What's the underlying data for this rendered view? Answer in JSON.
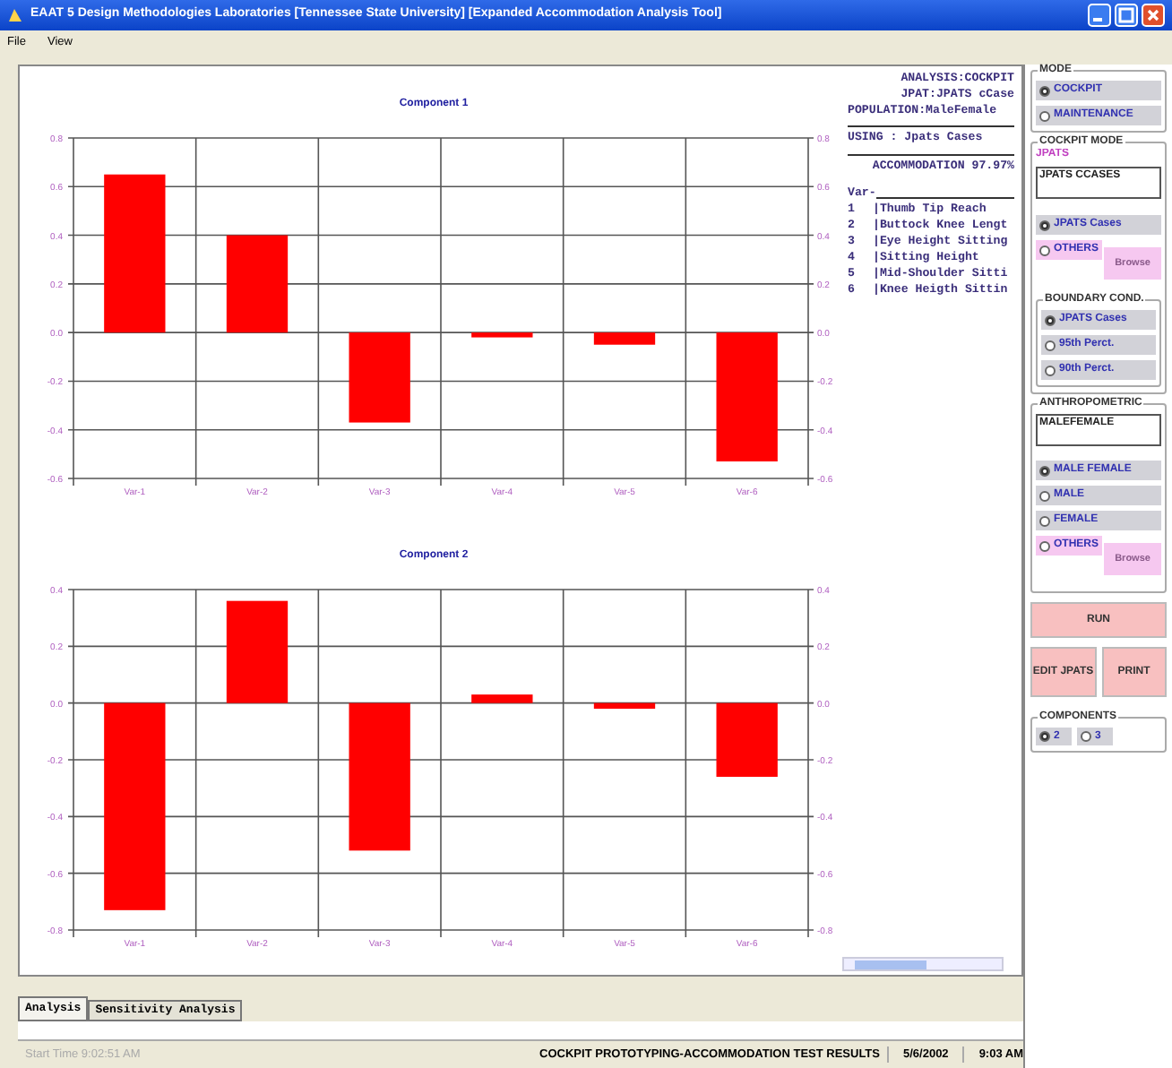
{
  "window": {
    "title": "EAAT 5 Design Methodologies Laboratories [Tennessee State University]   [Expanded Accommodation Analysis Tool]"
  },
  "menu": [
    "File",
    "View"
  ],
  "charts": [
    {
      "chart_data": {
        "type": "bar",
        "title": "Component 1",
        "categories": [
          "Var-1",
          "Var-2",
          "Var-3",
          "Var-4",
          "Var-5",
          "Var-6"
        ],
        "grid": true,
        "series": [
          {
            "color": "#ff0000",
            "values": [
              0.65,
              0.4,
              -0.37,
              -0.02,
              -0.05,
              -0.53
            ]
          }
        ],
        "ylim": [
          -0.6,
          0.8
        ],
        "yticks": [
          {
            "value": 0.8,
            "label": "0.8"
          },
          {
            "value": 0.6,
            "label": "0.6"
          },
          {
            "value": 0.4,
            "label": "0.4"
          },
          {
            "value": 0.2,
            "label": "0.2"
          },
          {
            "value": 0,
            "label": "0.0"
          },
          {
            "value": -0.2,
            "label": "-0.2"
          },
          {
            "value": -0.4,
            "label": "-0.4"
          },
          {
            "value": -0.6,
            "label": "-0.6"
          }
        ]
      }
    },
    {
      "chart_data": {
        "type": "bar",
        "title": "Component 2",
        "categories": [
          "Var-1",
          "Var-2",
          "Var-3",
          "Var-4",
          "Var-5",
          "Var-6"
        ],
        "grid": true,
        "series": [
          {
            "color": "#ff0000",
            "values": [
              -0.73,
              0.36,
              -0.52,
              0.03,
              -0.02,
              -0.26
            ]
          }
        ],
        "ylim": [
          -0.8,
          0.4
        ],
        "yticks": [
          {
            "value": 0.4,
            "label": "0.4"
          },
          {
            "value": 0.2,
            "label": "0.2"
          },
          {
            "value": 0,
            "label": "0.0"
          },
          {
            "value": -0.2,
            "label": "-0.2"
          },
          {
            "value": -0.4,
            "label": "-0.4"
          },
          {
            "value": -0.6,
            "label": "-0.6"
          },
          {
            "value": -0.8,
            "label": "-0.8"
          }
        ]
      }
    }
  ],
  "info": {
    "header": [
      "ANALYSIS:COCKPIT",
      "JPAT:JPATS cCase",
      "POPULATION:MaleFemale"
    ],
    "using": "USING : Jpats Cases",
    "accommodation": "ACCOMMODATION 97.97%",
    "var_heading": "Var-",
    "variables": [
      {
        "number": "1",
        "name": "|Thumb Tip Reach"
      },
      {
        "number": "2",
        "name": "|Buttock Knee Lengt"
      },
      {
        "number": "3",
        "name": "|Eye Height Sitting"
      },
      {
        "number": "4",
        "name": "|Sitting Height"
      },
      {
        "number": "5",
        "name": "|Mid-Shoulder Sitti"
      },
      {
        "number": "6",
        "name": "|Knee Heigth Sittin"
      }
    ]
  },
  "tabs": [
    {
      "label": "Analysis",
      "selected": true
    },
    {
      "label": "Sensitivity Analysis",
      "selected": false
    }
  ],
  "panel": {
    "mode": {
      "title": "MODE",
      "options": [
        {
          "label": "COCKPIT",
          "selected": true
        },
        {
          "label": "MAINTENANCE",
          "selected": false
        }
      ]
    },
    "cockpit_mode": {
      "title": "COCKPIT MODE",
      "jpats_label": "JPATS",
      "jpats_value": "JPATS CCASES",
      "options": [
        {
          "label": "JPATS Cases",
          "selected": true
        },
        {
          "label": "OTHERS",
          "selected": false,
          "browse": {
            "label": "Browse",
            "disabled": true
          }
        }
      ],
      "boundary": {
        "title": "BOUNDARY COND.",
        "options": [
          {
            "label": "JPATS Cases",
            "selected": true
          },
          {
            "label": "95th Perct.",
            "selected": false
          },
          {
            "label": "90th Perct.",
            "selected": false
          }
        ]
      }
    },
    "anthropometric": {
      "title": "ANTHROPOMETRIC",
      "value": "MALEFEMALE",
      "options": [
        {
          "label": "MALE FEMALE",
          "selected": true
        },
        {
          "label": "MALE",
          "selected": false
        },
        {
          "label": "FEMALE",
          "selected": false
        },
        {
          "label": "OTHERS",
          "selected": false,
          "browse": {
            "label": "Browse",
            "disabled": true
          }
        }
      ]
    },
    "run": "RUN",
    "edit": "EDIT JPATS",
    "print": "PRINT",
    "components": {
      "title": "COMPONENTS",
      "options": [
        {
          "label": "2",
          "selected": true
        },
        {
          "label": "3",
          "selected": false
        }
      ]
    }
  },
  "status_bar": {
    "start": "Start Time 9:02:51 AM",
    "message": "COCKPIT PROTOTYPING-ACCOMMODATION TEST RESULTS",
    "date": "5/6/2002",
    "time": "9:03 AM"
  }
}
